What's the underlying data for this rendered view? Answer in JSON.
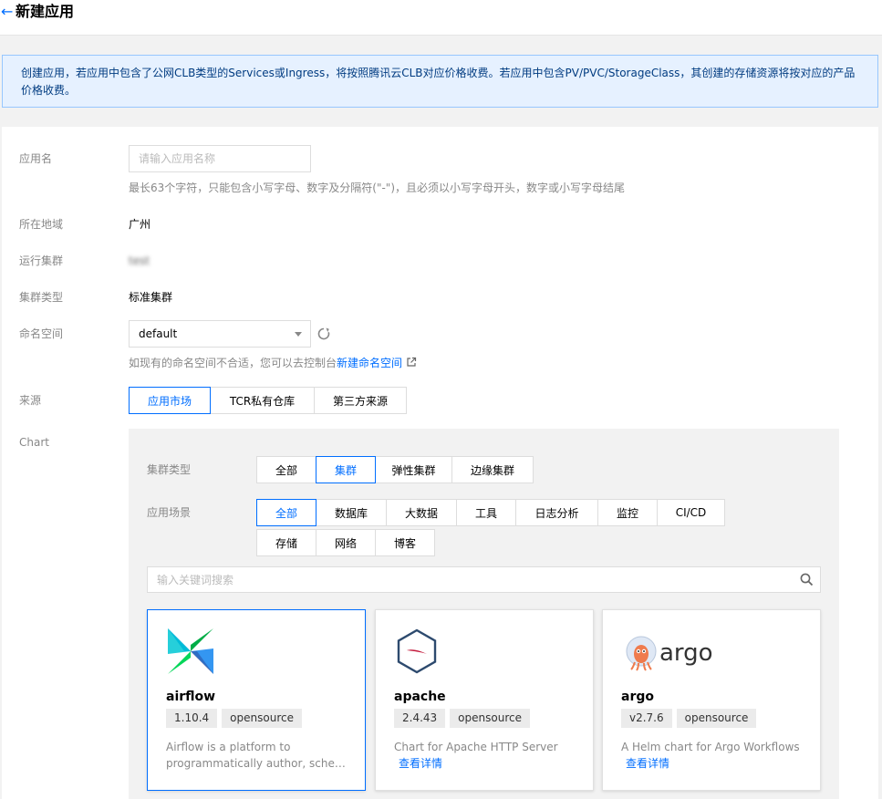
{
  "header": {
    "back_symbol": "←",
    "title": "新建应用"
  },
  "notice": {
    "text": "创建应用，若应用中包含了公网CLB类型的Services或Ingress，将按照腾讯云CLB对应价格收费。若应用中包含PV/PVC/StorageClass，其创建的存储资源将按对应的产品价格收费。"
  },
  "form": {
    "app_name": {
      "label": "应用名",
      "placeholder": "请输入应用名称",
      "value": "",
      "hint": "最长63个字符，只能包含小写字母、数字及分隔符(\"-\")，且必须以小写字母开头，数字或小写字母结尾"
    },
    "region": {
      "label": "所在地域",
      "value": "广州"
    },
    "cluster": {
      "label": "运行集群",
      "value": "test"
    },
    "cluster_type": {
      "label": "集群类型",
      "value": "标准集群"
    },
    "namespace": {
      "label": "命名空间",
      "value": "default",
      "hint_prefix": "如现有的命名空间不合适，您可以去控制台",
      "hint_link": "新建命名空间"
    },
    "source": {
      "label": "来源",
      "options": [
        "应用市场",
        "TCR私有仓库",
        "第三方来源"
      ],
      "selected": "应用市场"
    },
    "chart": {
      "label": "Chart"
    }
  },
  "chart_panel": {
    "cluster_type": {
      "label": "集群类型",
      "options": [
        "全部",
        "集群",
        "弹性集群",
        "边缘集群"
      ],
      "selected": "集群"
    },
    "scenario": {
      "label": "应用场景",
      "row1": [
        "全部",
        "数据库",
        "大数据",
        "工具",
        "日志分析",
        "监控",
        "CI/CD"
      ],
      "row2": [
        "存储",
        "网络",
        "博客"
      ],
      "selected": "全部"
    },
    "search": {
      "placeholder": "输入关键词搜索"
    },
    "cards": [
      {
        "name": "airflow",
        "version": "1.10.4",
        "tag": "opensource",
        "desc_line1": "Airflow is a platform to",
        "desc_line2": "programmatically author, schedul...",
        "selected": true
      },
      {
        "name": "apache",
        "version": "2.4.43",
        "tag": "opensource",
        "desc_line1": "Chart for Apache HTTP Server",
        "link": "查看详情"
      },
      {
        "name": "argo",
        "version": "v2.7.6",
        "tag": "opensource",
        "desc_line1": "A Helm chart for Argo Workflows",
        "link": "查看详情",
        "logo_text": "argo"
      }
    ]
  },
  "colors": {
    "accent": "#006eff",
    "notice_bg": "#e6f1ff",
    "notice_border": "#97c7ff"
  }
}
